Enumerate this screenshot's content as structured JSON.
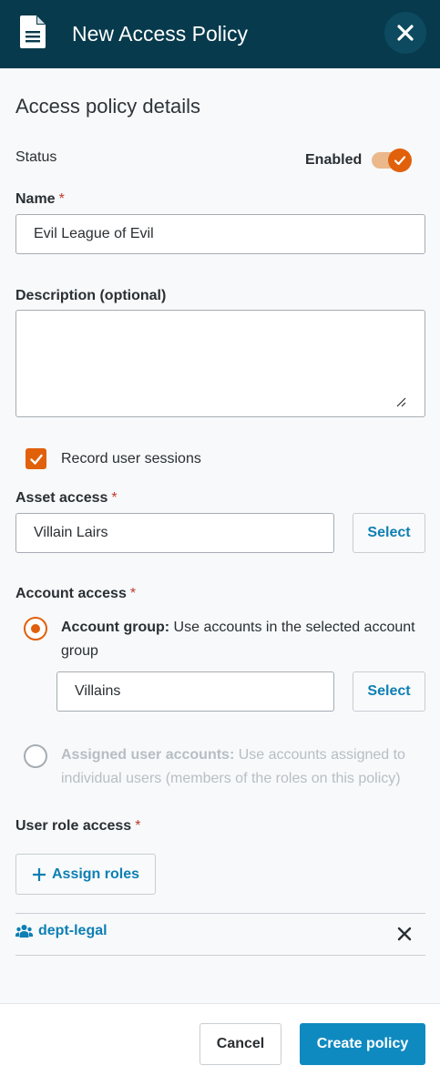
{
  "header": {
    "title": "New Access Policy",
    "icon": "document-icon",
    "close_icon": "close-icon",
    "bg_color": "#063a4c"
  },
  "form": {
    "section_title": "Access policy details",
    "status": {
      "label": "Status",
      "state_label": "Enabled",
      "enabled": true
    },
    "name": {
      "label": "Name",
      "required_mark": "*",
      "value": "Evil League of Evil"
    },
    "description": {
      "label": "Description (optional)",
      "value": ""
    },
    "record_sessions": {
      "label": "Record user sessions",
      "checked": true
    },
    "asset_access": {
      "label": "Asset access",
      "required_mark": "*",
      "value": "Villain Lairs",
      "select_label": "Select"
    },
    "account_access": {
      "label": "Account access",
      "required_mark": "*",
      "option_group": {
        "title": "Account group:",
        "description": "Use accounts in the selected account group",
        "selected": true,
        "value": "Villains",
        "select_label": "Select"
      },
      "option_assigned": {
        "title": "Assigned user accounts:",
        "description": "Use accounts assigned to individual users (members of the roles on this policy)",
        "selected": false,
        "disabled": true
      }
    },
    "user_role_access": {
      "label": "User role access",
      "required_mark": "*",
      "assign_label": "Assign roles",
      "roles": [
        {
          "name": "dept-legal",
          "icon": "users-group-icon"
        }
      ]
    }
  },
  "footer": {
    "cancel_label": "Cancel",
    "create_label": "Create policy"
  },
  "colors": {
    "accent": "#e1600b",
    "link": "#0e7fb3",
    "primary_button": "#0f8ac0",
    "required": "#c0392b"
  }
}
